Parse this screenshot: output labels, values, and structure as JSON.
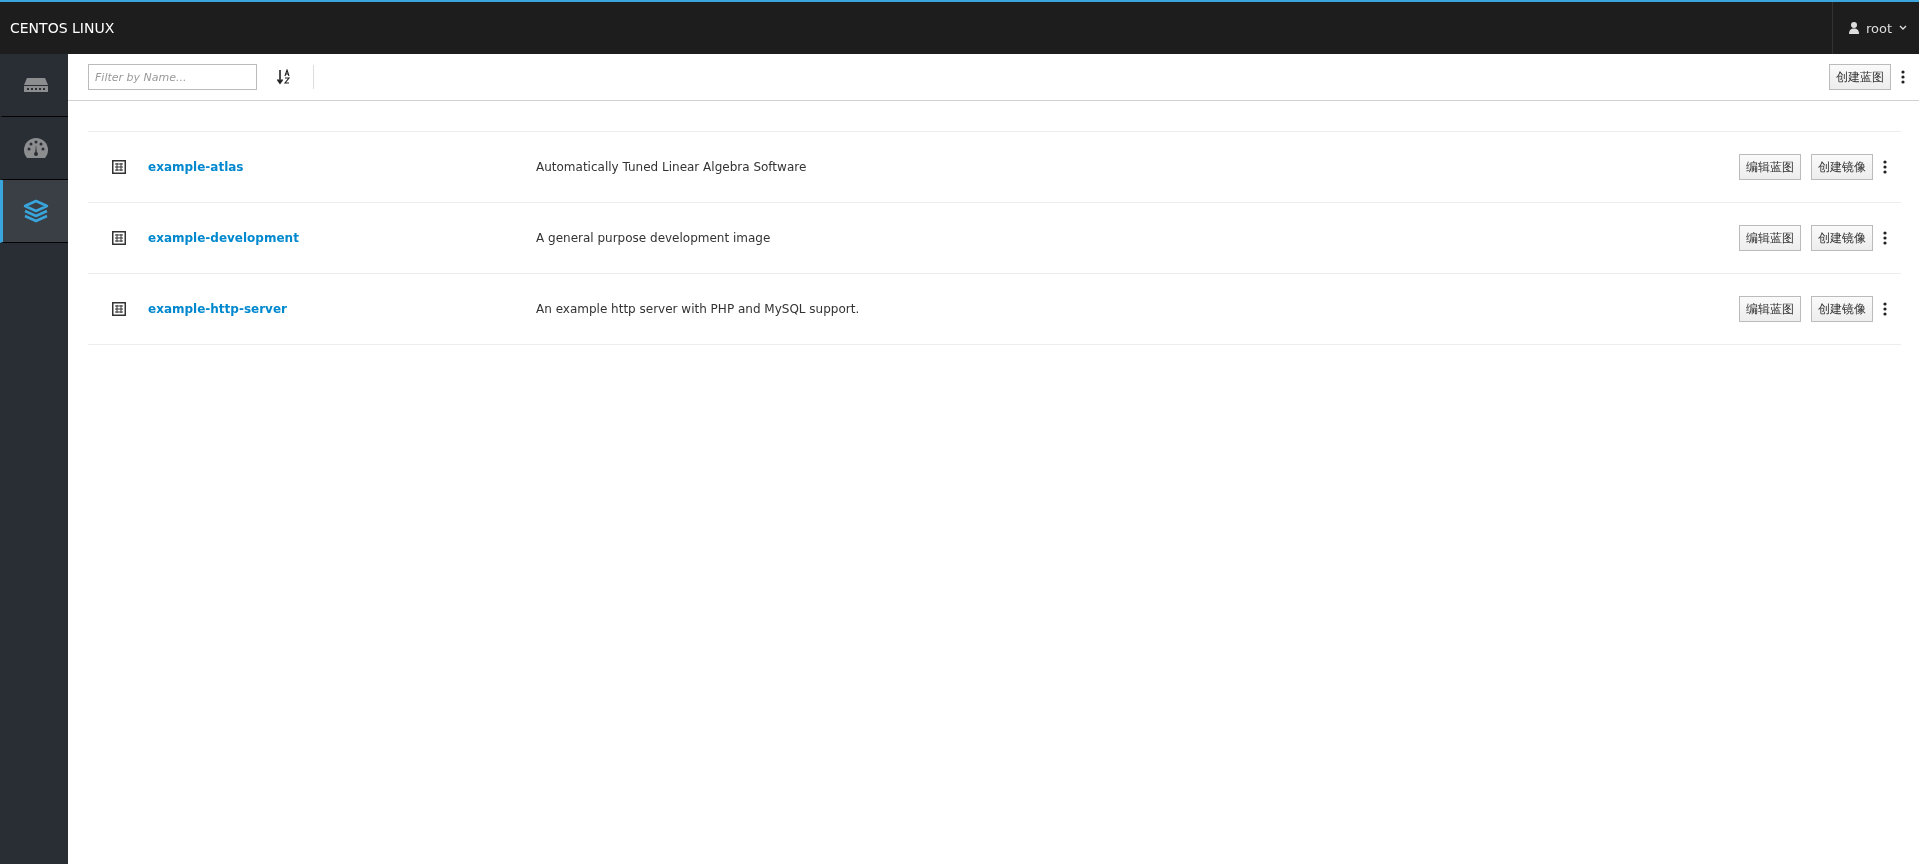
{
  "header": {
    "brand": "CENTOS LINUX",
    "user": "root"
  },
  "sidebar": {
    "items": [
      {
        "kind": "server",
        "selected": false
      },
      {
        "kind": "dashboard",
        "selected": false
      },
      {
        "kind": "layers",
        "selected": true
      }
    ]
  },
  "toolbar": {
    "filter": {
      "placeholder": "Filter by Name..."
    },
    "create_button": "创建蓝图"
  },
  "blueprints": [
    {
      "name": "example-atlas",
      "description": "Automatically Tuned Linear Algebra Software",
      "edit_button": "编辑蓝图",
      "create_image_button": "创建镜像"
    },
    {
      "name": "example-development",
      "description": "A general purpose development image",
      "edit_button": "编辑蓝图",
      "create_image_button": "创建镜像"
    },
    {
      "name": "example-http-server",
      "description": "An example http server with PHP and MySQL support.",
      "edit_button": "编辑蓝图",
      "create_image_button": "创建镜像"
    }
  ]
}
